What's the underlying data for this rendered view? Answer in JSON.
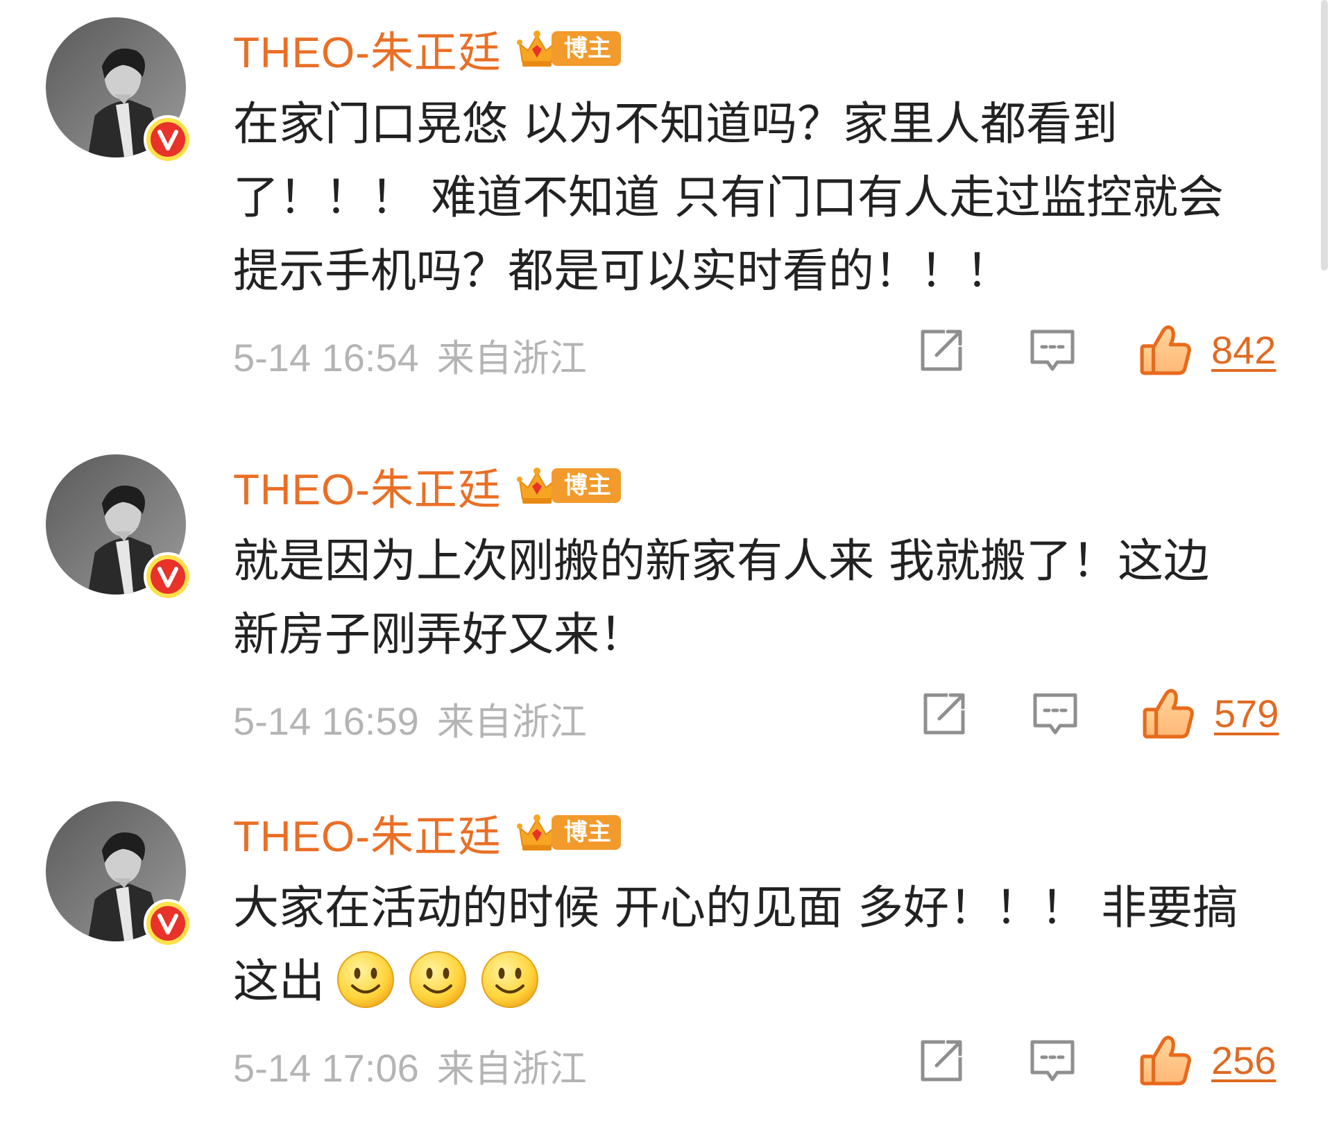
{
  "comments": [
    {
      "username": "THEO-朱正廷",
      "badge_label": "博主",
      "verified_letter": "V",
      "lines": [
        "在家门口晃悠 以为不知道吗？家里人都看到",
        "了！！！ 难道不知道 只有门口有人走过监控就会",
        "提示手机吗？都是可以实时看的！！！"
      ],
      "time": "5-14 16:54",
      "location": "来自浙江",
      "likes": "842"
    },
    {
      "username": "THEO-朱正廷",
      "badge_label": "博主",
      "verified_letter": "V",
      "lines": [
        "就是因为上次刚搬的新家有人来 我就搬了！这边",
        "新房子刚弄好又来！"
      ],
      "time": "5-14 16:59",
      "location": "来自浙江",
      "likes": "579"
    },
    {
      "username": "THEO-朱正廷",
      "badge_label": "博主",
      "verified_letter": "V",
      "lines": [
        "大家在活动的时候 开心的见面 多好！！！ 非要搞",
        "这出"
      ],
      "emojis": [
        "smile-emoji",
        "smile-emoji",
        "smile-emoji"
      ],
      "time": "5-14 17:06",
      "location": "来自浙江",
      "likes": "256"
    }
  ],
  "icons": {
    "share": "share-icon",
    "comment": "comment-icon",
    "like": "thumbs-up-icon",
    "crown": "crown-icon",
    "verified": "verified-v-icon"
  },
  "colors": {
    "username": "#ea6f26",
    "badge": "#f29a2b",
    "verified": "#e8322a",
    "like": "#e06a22",
    "meta": "#b4b4b4",
    "text": "#222222"
  }
}
